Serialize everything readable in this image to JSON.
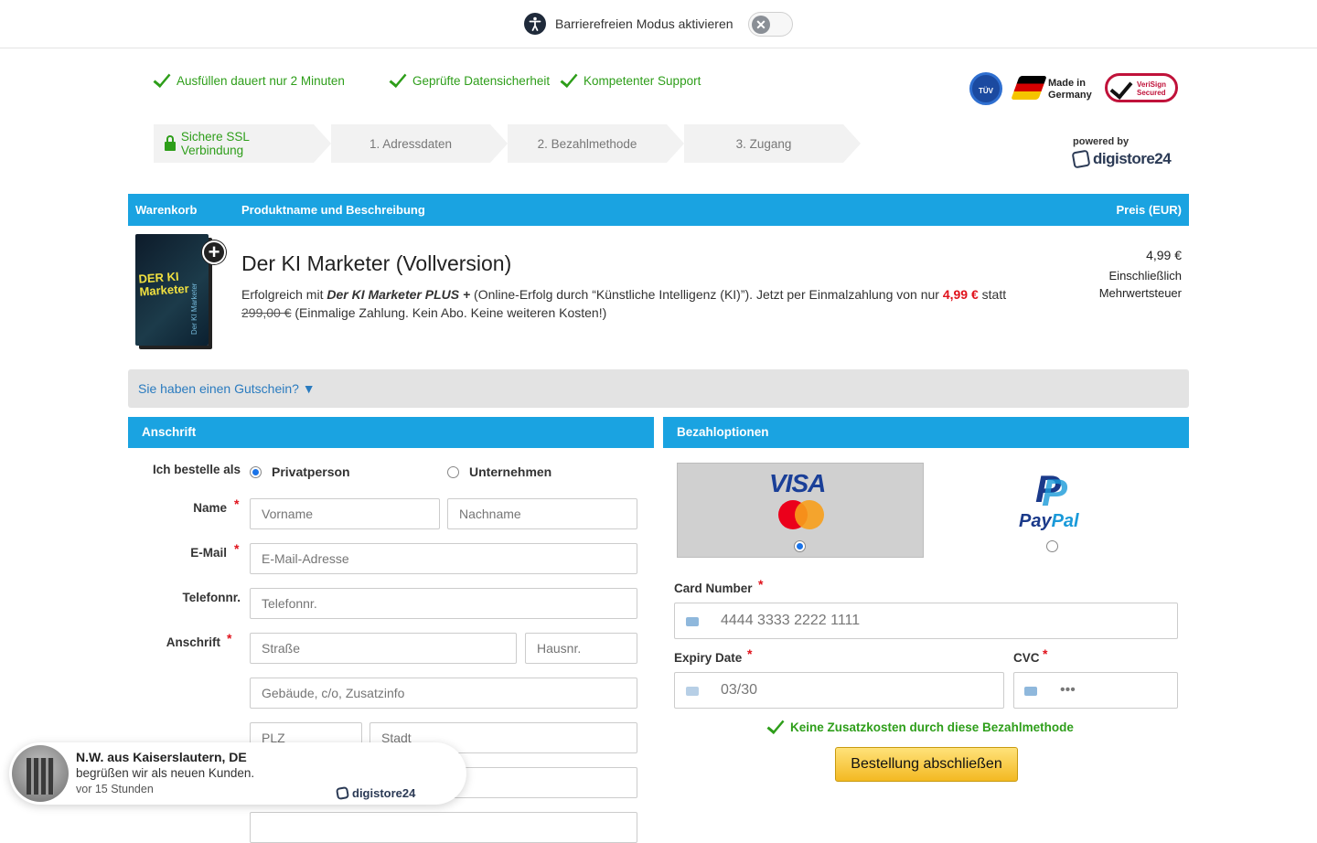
{
  "a11y": {
    "label": "Barrierefreien Modus aktivieren",
    "toggle_glyph": "✕"
  },
  "features": [
    "Ausfüllen dauert nur 2 Minuten",
    "Geprüfte Datensicherheit",
    "Kompetenter Support"
  ],
  "badges": {
    "tuv": "TÜV",
    "made_in_1": "Made in",
    "made_in_2": "Germany",
    "verisign_1": "VeriSign",
    "verisign_2": "Secured"
  },
  "steps": [
    "Sichere SSL Verbindung",
    "1. Adressdaten",
    "2. Bezahlmethode",
    "3. Zugang"
  ],
  "powered": {
    "label": "powered by",
    "brand": "digistore24"
  },
  "cart_header": {
    "col1": "Warenkorb",
    "col2": "Produktname und Beschreibung",
    "col3": "Preis (EUR)"
  },
  "product": {
    "image_title": "DER KI Marketer",
    "image_side": "Der KI Marketer",
    "title": "Der KI Marketer (Vollversion)",
    "desc_1": "Erfolgreich mit ",
    "desc_bold": "Der KI Marketer PLUS +",
    "desc_2": " (Online-Erfolg durch “Künstliche Intelligenz (KI)”). Jetzt per Einmalzahlung von nur ",
    "desc_price": "4,99 €",
    "desc_3": " statt ",
    "desc_old": "299,00 €",
    "desc_4": " (Einmalige Zahlung. Kein Abo. Keine weiteren Kosten!)",
    "price": "4,99 €",
    "vat_1": "Einschließlich",
    "vat_2": "Mehrwertsteuer"
  },
  "coupon": {
    "label": "Sie haben einen Gutschein? ▼"
  },
  "address": {
    "header": "Anschrift",
    "order_as": "Ich bestelle als",
    "opt_private": "Privatperson",
    "opt_company": "Unternehmen",
    "name_label": "Name",
    "email_label": "E-Mail",
    "phone_label": "Telefonnr.",
    "address_label": "Anschrift",
    "ph_first": "Vorname",
    "ph_last": "Nachname",
    "ph_email": "E-Mail-Adresse",
    "ph_phone": "Telefonnr.",
    "ph_street": "Straße",
    "ph_no": "Hausnr.",
    "ph_building": "Gebäude, c/o, Zusatzinfo",
    "ph_zip": "PLZ",
    "ph_city": "Stadt",
    "required": "*"
  },
  "payment": {
    "header": "Bezahloptionen",
    "visa": "VISA",
    "paypal_pay": "Pay",
    "paypal_pal": "Pal",
    "card_label": "Card Number",
    "card_value": "4444 3333 2222 1111",
    "expiry_label": "Expiry Date",
    "expiry_value": "03/30",
    "cvc_label": "CVC",
    "cvc_value": "•••",
    "no_cost": "Keine Zusatzkosten durch diese Bezahlmethode",
    "order_button": "Bestellung abschließen"
  },
  "toast": {
    "title": "N.W. aus Kaiserslautern, DE",
    "message": "begrüßen wir als neuen Kunden.",
    "time": "vor 15 Stunden",
    "brand": "digistore24"
  },
  "colors": {
    "accent": "#1aa3e1",
    "success": "#2e9e1a",
    "danger": "#e0131c",
    "button": "#f3b922"
  }
}
